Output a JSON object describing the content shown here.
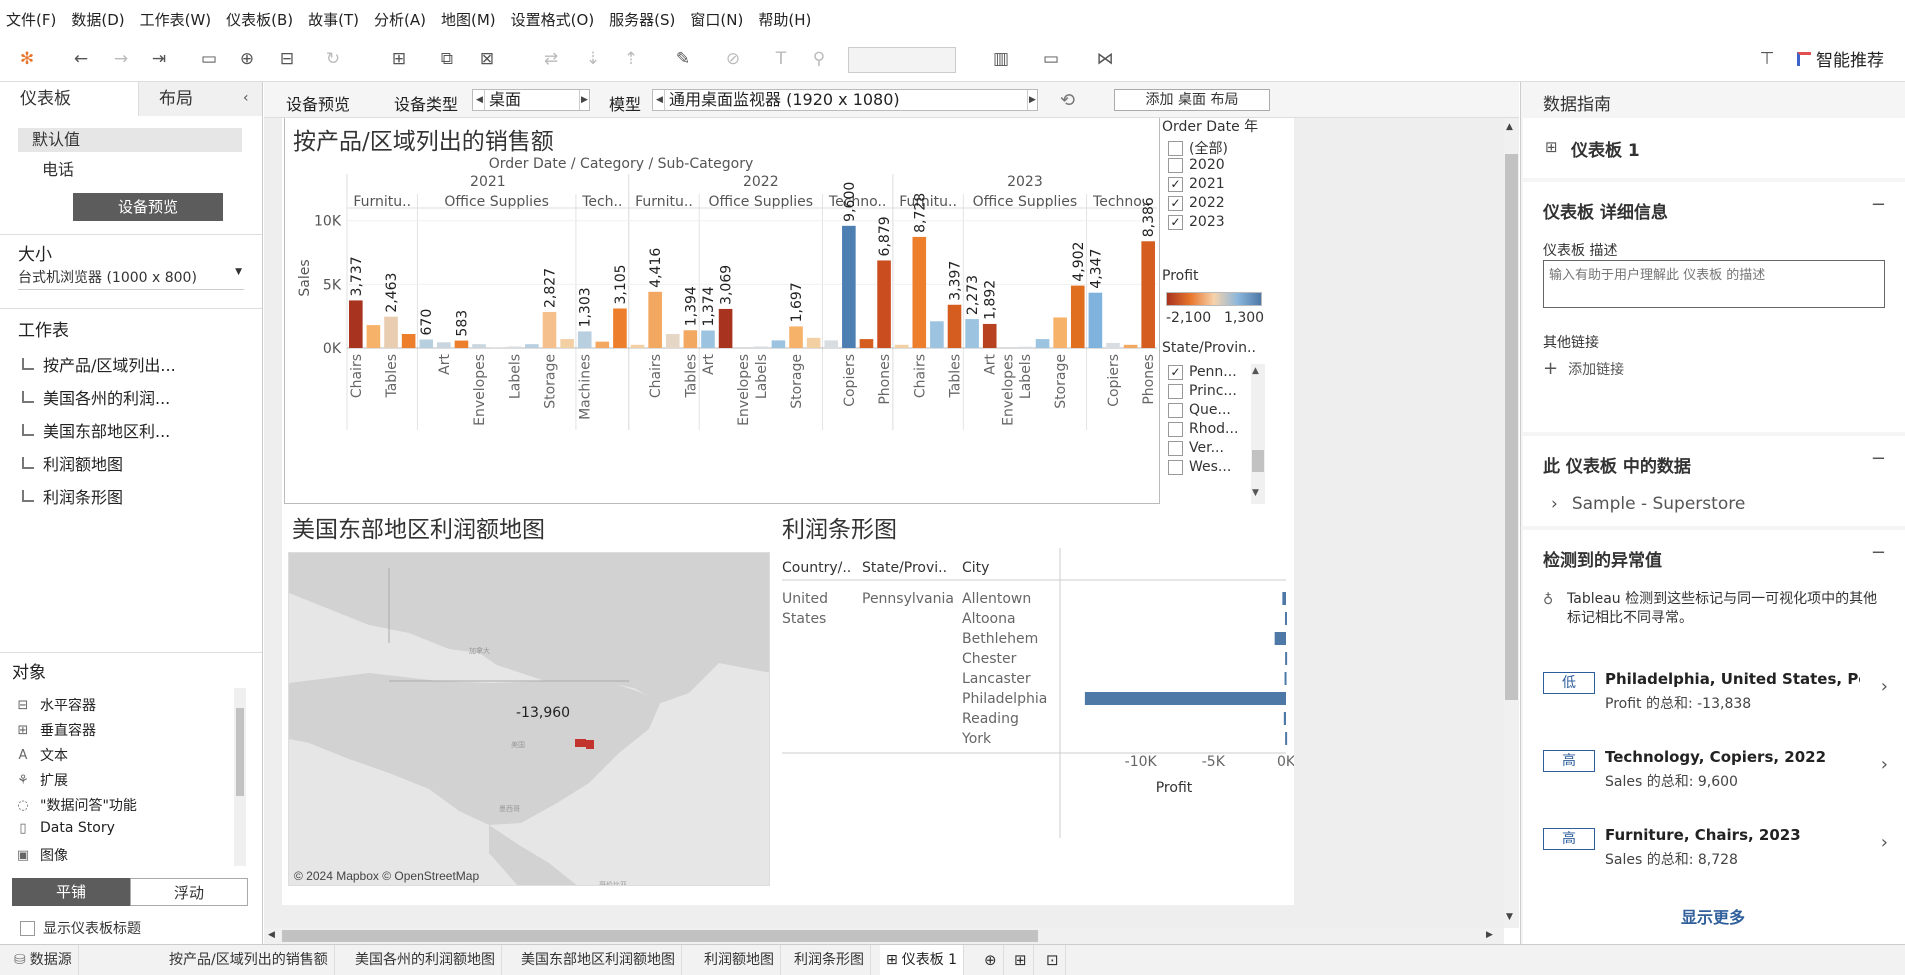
{
  "menu": [
    "文件(F)",
    "数据(D)",
    "工作表(W)",
    "仪表板(B)",
    "故事(T)",
    "分析(A)",
    "地图(M)",
    "设置格式(O)",
    "服务器(S)",
    "窗口(N)",
    "帮助(H)"
  ],
  "toolbar": {
    "smart_label": "智能推荐"
  },
  "left": {
    "tab_dashboard": "仪表板",
    "tab_layout": "布局",
    "default_value": "默认值",
    "phone": "电话",
    "device_preview_btn": "设备预览",
    "size_title": "大小",
    "size_value": "台式机浏览器 (1000 x 800)",
    "worksheets_title": "工作表",
    "worksheets": [
      "按产品/区域列出...",
      "美国各州的利润...",
      "美国东部地区利...",
      "利润额地图",
      "利润条形图"
    ],
    "objects_title": "对象",
    "objects": [
      "水平容器",
      "垂直容器",
      "文本",
      "扩展",
      "\"数据问答\"功能",
      "Data Story",
      "图像"
    ],
    "tiled": "平铺",
    "floating": "浮动",
    "show_title": "显示仪表板标题"
  },
  "devicebar": {
    "preview": "设备预览",
    "device_type_label": "设备类型",
    "device_type_value": "桌面",
    "model_label": "模型",
    "model_value": "通用桌面监视器 (1920 x 1080)",
    "add_layout": "添加 桌面 布局"
  },
  "sheets": {
    "sales_title": "按产品/区域列出的销售额",
    "map_title": "美国东部地区利润额地图",
    "bar_title": "利润条形图"
  },
  "chart_data": [
    {
      "type": "bar",
      "title": "按产品/区域列出的销售额",
      "header": "Order Date / Category / Sub-Category",
      "ylabel": "Sales",
      "yticks": [
        "10K",
        "5K",
        "0K"
      ],
      "ylim": [
        0,
        11000
      ],
      "years": [
        "2021",
        "2022",
        "2023"
      ],
      "category_headers": [
        "Furnitu..",
        "Office Supplies",
        "Tech..",
        "Furnitu..",
        "Office Supplies",
        "Techno..",
        "Furnitu..",
        "Office Supplies",
        "Techno.."
      ],
      "bars": [
        {
          "year": "2021",
          "cat": "Furniture",
          "sub": "Chairs",
          "value": 3737,
          "color": "#a8331f",
          "label": "3,737"
        },
        {
          "year": "2021",
          "cat": "Furniture",
          "sub": "",
          "value": 1800,
          "color": "#f7b26a",
          "label": ""
        },
        {
          "year": "2021",
          "cat": "Furniture",
          "sub": "Tables",
          "value": 2463,
          "color": "#e9cdb0",
          "label": "2,463"
        },
        {
          "year": "2021",
          "cat": "Furniture",
          "sub": "",
          "value": 1100,
          "color": "#ed7e2c",
          "label": ""
        },
        {
          "year": "2021",
          "cat": "Office Supplies",
          "sub": "",
          "value": 670,
          "color": "#b8cfdf",
          "label": "670"
        },
        {
          "year": "2021",
          "cat": "Office Supplies",
          "sub": "Art",
          "value": 450,
          "color": "#c9d6df",
          "label": ""
        },
        {
          "year": "2021",
          "cat": "Office Supplies",
          "sub": "",
          "value": 583,
          "color": "#ed7e2c",
          "label": "583"
        },
        {
          "year": "2021",
          "cat": "Office Supplies",
          "sub": "Envelopes",
          "value": 300,
          "color": "#c9d6df",
          "label": ""
        },
        {
          "year": "2021",
          "cat": "Office Supplies",
          "sub": "",
          "value": 60,
          "color": "#d8dde2",
          "label": ""
        },
        {
          "year": "2021",
          "cat": "Office Supplies",
          "sub": "Labels",
          "value": 120,
          "color": "#d8dde2",
          "label": ""
        },
        {
          "year": "2021",
          "cat": "Office Supplies",
          "sub": "",
          "value": 300,
          "color": "#b8cfdf",
          "label": ""
        },
        {
          "year": "2021",
          "cat": "Office Supplies",
          "sub": "Storage",
          "value": 2827,
          "color": "#f5c08c",
          "label": "2,827"
        },
        {
          "year": "2021",
          "cat": "Office Supplies",
          "sub": "",
          "value": 700,
          "color": "#f3cfa4",
          "label": ""
        },
        {
          "year": "2021",
          "cat": "Technology",
          "sub": "Machines",
          "value": 1303,
          "color": "#b8cfdf",
          "label": "1,303"
        },
        {
          "year": "2021",
          "cat": "Technology",
          "sub": "",
          "value": 500,
          "color": "#f3a861",
          "label": ""
        },
        {
          "year": "2021",
          "cat": "Technology",
          "sub": "",
          "value": 3105,
          "color": "#ed7e2c",
          "label": "3,105"
        },
        {
          "year": "2022",
          "cat": "Furniture",
          "sub": "",
          "value": 250,
          "color": "#f3cfa4",
          "label": ""
        },
        {
          "year": "2022",
          "cat": "Furniture",
          "sub": "Chairs",
          "value": 4416,
          "color": "#f3a861",
          "label": "4,416"
        },
        {
          "year": "2022",
          "cat": "Furniture",
          "sub": "",
          "value": 1100,
          "color": "#e5d6c6",
          "label": ""
        },
        {
          "year": "2022",
          "cat": "Furniture",
          "sub": "Tables",
          "value": 1394,
          "color": "#f3a861",
          "label": "1,394"
        },
        {
          "year": "2022",
          "cat": "Office Supplies",
          "sub": "Art",
          "value": 1374,
          "color": "#9cc3e0",
          "label": "1,374"
        },
        {
          "year": "2022",
          "cat": "Office Supplies",
          "sub": "",
          "value": 3069,
          "color": "#a8331f",
          "label": "3,069"
        },
        {
          "year": "2022",
          "cat": "Office Supplies",
          "sub": "Envelopes",
          "value": 80,
          "color": "#d8dde2",
          "label": ""
        },
        {
          "year": "2022",
          "cat": "Office Supplies",
          "sub": "Labels",
          "value": 120,
          "color": "#d8dde2",
          "label": ""
        },
        {
          "year": "2022",
          "cat": "Office Supplies",
          "sub": "",
          "value": 600,
          "color": "#9cc3e0",
          "label": ""
        },
        {
          "year": "2022",
          "cat": "Office Supplies",
          "sub": "Storage",
          "value": 1697,
          "color": "#f7b26a",
          "label": "1,697"
        },
        {
          "year": "2022",
          "cat": "Office Supplies",
          "sub": "",
          "value": 800,
          "color": "#f3cfa4",
          "label": ""
        },
        {
          "year": "2022",
          "cat": "Technology",
          "sub": "",
          "value": 600,
          "color": "#d8dde2",
          "label": ""
        },
        {
          "year": "2022",
          "cat": "Technology",
          "sub": "Copiers",
          "value": 9600,
          "color": "#4e7fb3",
          "label": "9,600"
        },
        {
          "year": "2022",
          "cat": "Technology",
          "sub": "",
          "value": 700,
          "color": "#d45d1f",
          "label": ""
        },
        {
          "year": "2022",
          "cat": "Technology",
          "sub": "Phones",
          "value": 6879,
          "color": "#c94d1f",
          "label": "6,879"
        },
        {
          "year": "2023",
          "cat": "Furniture",
          "sub": "",
          "value": 250,
          "color": "#f3cfa4",
          "label": ""
        },
        {
          "year": "2023",
          "cat": "Furniture",
          "sub": "Chairs",
          "value": 8728,
          "color": "#ed7e2c",
          "label": "8,728"
        },
        {
          "year": "2023",
          "cat": "Furniture",
          "sub": "",
          "value": 2100,
          "color": "#9cc3e0",
          "label": ""
        },
        {
          "year": "2023",
          "cat": "Furniture",
          "sub": "Tables",
          "value": 3397,
          "color": "#d45d1f",
          "label": "3,397"
        },
        {
          "year": "2023",
          "cat": "Office Supplies",
          "sub": "",
          "value": 2273,
          "color": "#9cc3e0",
          "label": "2,273"
        },
        {
          "year": "2023",
          "cat": "Office Supplies",
          "sub": "Art",
          "value": 1892,
          "color": "#b8421f",
          "label": "1,892"
        },
        {
          "year": "2023",
          "cat": "Office Supplies",
          "sub": "Envelopes",
          "value": 80,
          "color": "#d8dde2",
          "label": ""
        },
        {
          "year": "2023",
          "cat": "Office Supplies",
          "sub": "Labels",
          "value": 100,
          "color": "#d8dde2",
          "label": ""
        },
        {
          "year": "2023",
          "cat": "Office Supplies",
          "sub": "",
          "value": 700,
          "color": "#9cc3e0",
          "label": ""
        },
        {
          "year": "2023",
          "cat": "Office Supplies",
          "sub": "Storage",
          "value": 2400,
          "color": "#f7b26a",
          "label": ""
        },
        {
          "year": "2023",
          "cat": "Office Supplies",
          "sub": "",
          "value": 4902,
          "color": "#e06f1f",
          "label": "4,902"
        },
        {
          "year": "2023",
          "cat": "Technology",
          "sub": "",
          "value": 4347,
          "color": "#7fb2dc",
          "label": "4,347"
        },
        {
          "year": "2023",
          "cat": "Technology",
          "sub": "Copiers",
          "value": 400,
          "color": "#d8dde2",
          "label": ""
        },
        {
          "year": "2023",
          "cat": "Technology",
          "sub": "",
          "value": 250,
          "color": "#f3a861",
          "label": ""
        },
        {
          "year": "2023",
          "cat": "Technology",
          "sub": "Phones",
          "value": 8386,
          "color": "#d45d1f",
          "label": "8,386"
        }
      ]
    },
    {
      "type": "bar",
      "title": "利润条形图",
      "orientation": "horizontal",
      "columns": [
        "Country/..",
        "State/Provi..",
        "City"
      ],
      "country": [
        "United",
        "States"
      ],
      "state": "Pennsylvania",
      "categories": [
        "Allentown",
        "Altoona",
        "Bethlehem",
        "Chester",
        "Lancaster",
        "Philadelphia",
        "Reading",
        "York"
      ],
      "values": [
        -250,
        -70,
        -780,
        -60,
        -100,
        -13838,
        -150,
        -60
      ],
      "xticks": [
        "-10K",
        "-5K",
        "0K"
      ],
      "xlim": [
        -15000,
        0
      ],
      "xlabel": "Profit",
      "color": "#4e79a7"
    }
  ],
  "map": {
    "label": "-13,960",
    "attribution": "© 2024 Mapbox © OpenStreetMap"
  },
  "filters": {
    "order_date_title": "Order Date 年",
    "years": [
      {
        "label": "(全部)",
        "checked": false
      },
      {
        "label": "2020",
        "checked": false
      },
      {
        "label": "2021",
        "checked": true
      },
      {
        "label": "2022",
        "checked": true
      },
      {
        "label": "2023",
        "checked": true
      }
    ],
    "profit_title": "Profit",
    "profit_min": "-2,100",
    "profit_max": "1,300",
    "state_title": "State/Provin..",
    "states": [
      {
        "label": "Penn...",
        "checked": true
      },
      {
        "label": "Princ...",
        "checked": false
      },
      {
        "label": "Que...",
        "checked": false
      },
      {
        "label": "Rhod...",
        "checked": false
      },
      {
        "label": "Ver...",
        "checked": false
      },
      {
        "label": "Wes...",
        "checked": false
      }
    ]
  },
  "right": {
    "title": "数据指南",
    "dashboard_name": "仪表板 1",
    "details_title": "仪表板 详细信息",
    "desc_label": "仪表板 描述",
    "desc_placeholder": "输入有助于用户理解此 仪表板 的描述",
    "links_label": "其他链接",
    "add_link": "添加链接",
    "data_title": "此 仪表板 中的数据",
    "datasource": "Sample - Superstore",
    "anomaly_title": "检测到的异常值",
    "anomaly_desc": "Tableau 检测到这些标记与同一可视化项中的其他标记相比不同寻常。",
    "anomalies": [
      {
        "tag": "低",
        "title": "Philadelphia, United States, Penns...",
        "sub": "Profit 的总和: -13,838"
      },
      {
        "tag": "高",
        "title": "Technology, Copiers, 2022",
        "sub": "Sales 的总和: 9,600"
      },
      {
        "tag": "高",
        "title": "Furniture, Chairs, 2023",
        "sub": "Sales 的总和: 8,728"
      }
    ],
    "show_more": "显示更多"
  },
  "bottom": {
    "datasource": "数据源",
    "tabs": [
      "按产品/区域列出的销售额",
      "美国各州的利润额地图",
      "美国东部地区利润额地图",
      "利润额地图",
      "利润条形图",
      "仪表板 1"
    ]
  }
}
